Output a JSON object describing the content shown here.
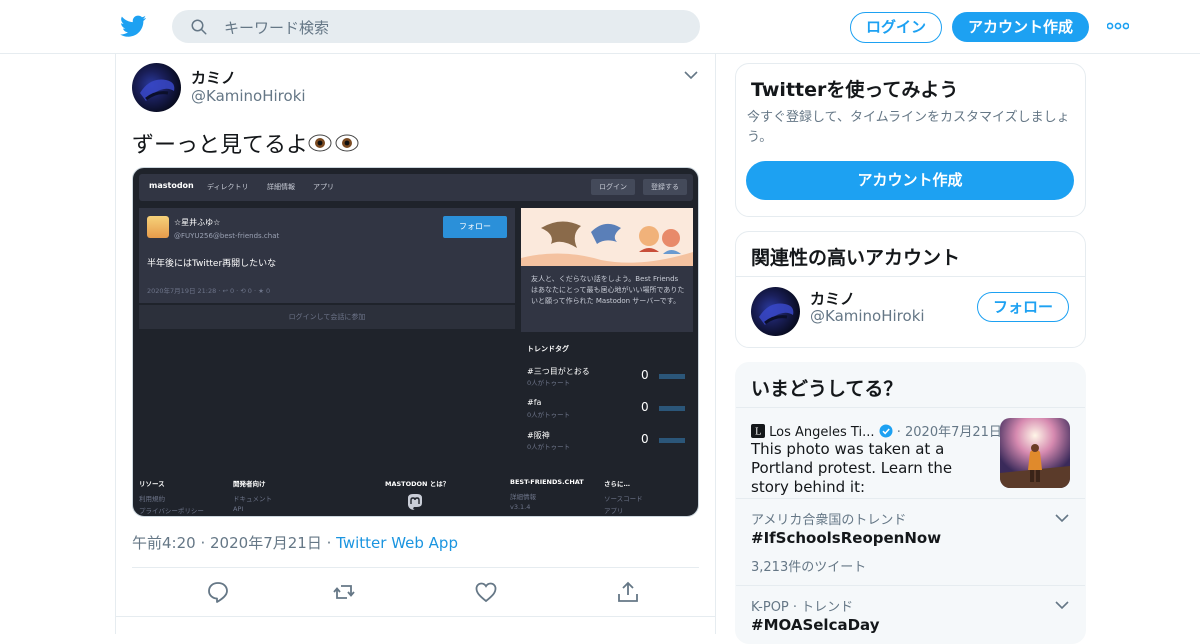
{
  "colors": {
    "brand": "#1da1f2",
    "link": "#1b95e0",
    "text": "#14171a",
    "muted": "#657786",
    "border": "#e6ecf0"
  },
  "header": {
    "logo_icon": "twitter-bird-icon",
    "search_placeholder": "キーワード検索",
    "login_label": "ログイン",
    "signup_label": "アカウント作成",
    "more_icon": "more-dots-icon"
  },
  "tweet": {
    "author_name": "カミノ",
    "author_handle": "@KaminoHiroki",
    "text": "ずーっと見てるよ",
    "emoji_icon": "eyes-emoji-icon",
    "time": "午前4:20",
    "date": "2020年7月21日",
    "source": "Twitter Web App",
    "actions": [
      "reply-icon",
      "retweet-icon",
      "like-icon",
      "share-icon"
    ],
    "embedded_image": {
      "logo": "mastodon",
      "nav": [
        "ディレクトリ",
        "詳細情報",
        "アプリ"
      ],
      "login_btn": "ログイン",
      "signup_btn": "登録する",
      "status_name": "☆星井ふゆ☆",
      "status_handle": "@FUYU256@best-friends.chat",
      "follow_btn": "フォロー",
      "status_text": "半年後にはTwitter再開したいな",
      "status_meta": "2020年7月19日 21:28 · ↩ 0 · ⟲ 0 · ★ 0",
      "login_to_join": "ログインして会話に参加",
      "card_desc": "友人と、くだらない話をしよう。Best Friends はあなたにとって最も居心地がいい場所でありたいと願って作られた Mastodon サーバーです。",
      "trend_heading": "トレンドタグ",
      "trends": [
        {
          "tag": "#三つ目がとおる",
          "count_label": "0人がトゥート",
          "value": "0"
        },
        {
          "tag": "#fa",
          "count_label": "0人がトゥート",
          "value": "0"
        },
        {
          "tag": "#阪神",
          "count_label": "0人がトゥート",
          "value": "0"
        }
      ],
      "footer": [
        {
          "heading": "リソース",
          "items": [
            "利用規約",
            "プライバシーポリシー"
          ]
        },
        {
          "heading": "開発者向け",
          "items": [
            "ドキュメント",
            "API"
          ]
        },
        {
          "heading": "MASTODON とは？",
          "items": []
        },
        {
          "heading": "BEST-FRIENDS.CHAT",
          "items": [
            "詳細情報",
            "v3.1.4"
          ]
        },
        {
          "heading": "さらに…",
          "items": [
            "ソースコード",
            "アプリ"
          ]
        }
      ]
    }
  },
  "sidebar": {
    "signup_card": {
      "title": "Twitterを使ってみよう",
      "desc": "今すぐ登録して、タイムラインをカスタマイズしましょう。",
      "button": "アカウント作成"
    },
    "related_card": {
      "title": "関連性の高いアカウント",
      "name": "カミノ",
      "handle": "@KaminoHiroki",
      "follow_label": "フォロー"
    },
    "happening_card": {
      "title": "いまどうしてる？",
      "news": {
        "source": "Los Angeles Ti...",
        "date": "2020年7月21日",
        "text": "This photo was taken at a Portland protest. Learn the story behind it:"
      },
      "trends": [
        {
          "context": "アメリカ合衆国のトレンド",
          "name": "#IfSchoolsReopenNow",
          "count": "3,213件のツイート"
        },
        {
          "context": "K-POP · トレンド",
          "name": "#MOASelcaDay",
          "count": ""
        }
      ]
    }
  }
}
